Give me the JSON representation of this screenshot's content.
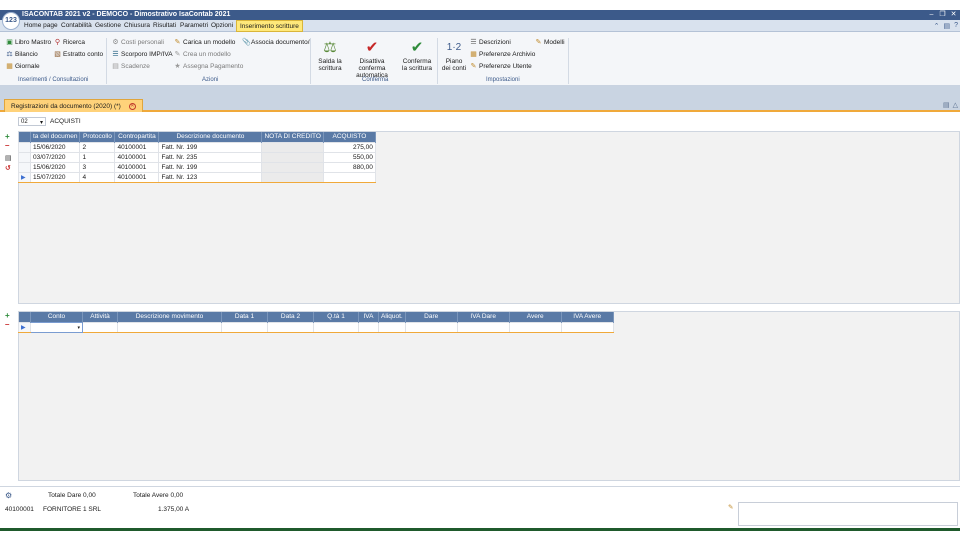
{
  "app": {
    "title": "ISACONTAB 2021 v2 - DEMOCO - Dimostrativo IsaContab 2021",
    "logo": "123"
  },
  "menu": {
    "items": [
      "Home page",
      "Contabilità",
      "Gestione",
      "Chiusura",
      "Risultati",
      "Parametri",
      "Opzioni"
    ],
    "active": "Inserimento scritture"
  },
  "ribbon": {
    "inserimenti": {
      "libro_mastro": "Libro Mastro",
      "ricerca": "Ricerca",
      "bilancio": "Bilancio",
      "estratto_conto": "Estratto conto",
      "giornale": "Giornale",
      "group": "Inserimenti / Consultazioni"
    },
    "azioni": {
      "costi_personali": "Costi personali",
      "carica_modello": "Carica un modello",
      "associa_documenti": "Associa documento/i",
      "scorporo": "Scorporo IMP/IVA",
      "crea_modello": "Crea un modello",
      "scadenze": "Scadenze",
      "assegna_pagamento": "Assegna Pagamento",
      "group": "Azioni"
    },
    "conferma": {
      "salda_1": "Salda la",
      "salda_2": "scrittura",
      "disattiva_1": "Disattiva conferma",
      "disattiva_2": "automatica",
      "conferma_1": "Conferma",
      "conferma_2": "la scrittura",
      "group": "Conferma"
    },
    "impostazioni": {
      "piano_1": "Piano",
      "piano_2": "dei conti",
      "descrizioni": "Descrizioni",
      "modelli": "Modelli",
      "preferenze_archivio": "Preferenze Archivio",
      "preferenze_utente": "Preferenze Utente",
      "group": "Impostazioni"
    }
  },
  "tab": {
    "label": "Registrazioni da documento (2020) (*)"
  },
  "registry": {
    "code": "02",
    "name": "ACQUISTI"
  },
  "documents": {
    "columns": [
      "ta del documen",
      "Protocollo",
      "Contropartita",
      "Descrizione documento",
      "NOTA DI CREDITO",
      "ACQUISTO"
    ],
    "rows": [
      [
        "15/06/2020",
        "2",
        "40100001",
        "Fatt. Nr. 199",
        "",
        "275,00"
      ],
      [
        "03/07/2020",
        "1",
        "40100001",
        "Fatt. Nr. 235",
        "",
        "550,00"
      ],
      [
        "15/06/2020",
        "3",
        "40100001",
        "Fatt. Nr. 199",
        "",
        "880,00"
      ],
      [
        "15/07/2020",
        "4",
        "40100001",
        "Fatt. Nr. 123",
        "",
        ""
      ]
    ]
  },
  "movements": {
    "columns": [
      "Conto",
      "Attività",
      "Descrizione movimento",
      "Data 1",
      "Data 2",
      "Q.tà 1",
      "IVA",
      "Aliquot.",
      "Dare",
      "IVA Dare",
      "Avere",
      "IVA Avere"
    ]
  },
  "status": {
    "totale_dare": "Totale Dare 0,00",
    "totale_avere": "Totale Avere 0,00",
    "account_code": "40100001",
    "account_name": "FORNITORE 1 SRL",
    "balance": "1.375,00 A"
  },
  "colors": {
    "titlebar": "#3c5a8a",
    "header": "#5a7aa6",
    "active_tab": "#ffd27a",
    "accent": "#f0a93a"
  }
}
